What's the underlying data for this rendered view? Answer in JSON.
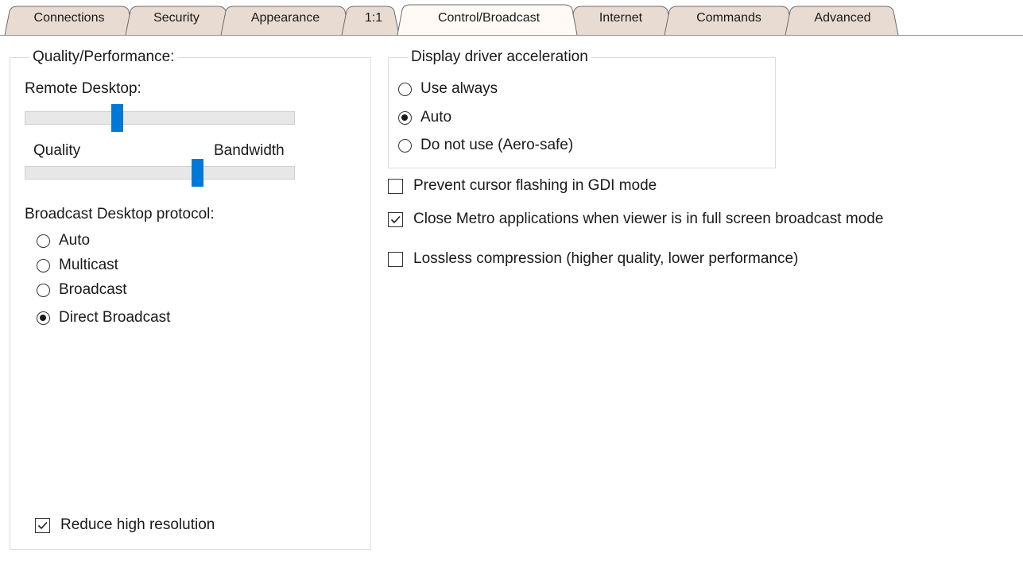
{
  "tabs": [
    {
      "label": "Connections",
      "selected": false
    },
    {
      "label": "Security",
      "selected": false
    },
    {
      "label": "Appearance",
      "selected": false
    },
    {
      "label": "1:1",
      "selected": false
    },
    {
      "label": "Control/Broadcast",
      "selected": true
    },
    {
      "label": "Internet",
      "selected": false
    },
    {
      "label": "Commands",
      "selected": false
    },
    {
      "label": "Advanced",
      "selected": false
    }
  ],
  "quality": {
    "legend": "Quality/Performance:",
    "remote_desktop_label": "Remote Desktop:",
    "remote_slider_value": 0.34,
    "quality_label": "Quality",
    "bandwidth_label": "Bandwidth",
    "qb_slider_value": 0.64,
    "protocol_label": "Broadcast Desktop protocol:",
    "protocol_options": [
      {
        "label": "Auto",
        "checked": false
      },
      {
        "label": "Multicast",
        "checked": false
      },
      {
        "label": "Broadcast",
        "checked": false
      },
      {
        "label": "Direct Broadcast",
        "checked": true
      }
    ],
    "reduce_high_resolution": {
      "label": "Reduce high resolution",
      "checked": true
    }
  },
  "display_driver": {
    "legend": "Display driver acceleration",
    "options": [
      {
        "label": "Use always",
        "checked": false
      },
      {
        "label": "Auto",
        "checked": true
      },
      {
        "label": "Do not use (Aero-safe)",
        "checked": false
      }
    ]
  },
  "options": [
    {
      "label": "Prevent cursor flashing in GDI mode",
      "checked": false
    },
    {
      "label": "Close Metro applications when viewer is in full screen broadcast mode",
      "checked": true
    },
    {
      "label": "Lossless compression (higher quality, lower performance)",
      "checked": false
    }
  ],
  "colors": {
    "accent": "#0078d7",
    "tab_fill": "#e8dcd2",
    "tab_selected_fill": "#fffaf5"
  }
}
